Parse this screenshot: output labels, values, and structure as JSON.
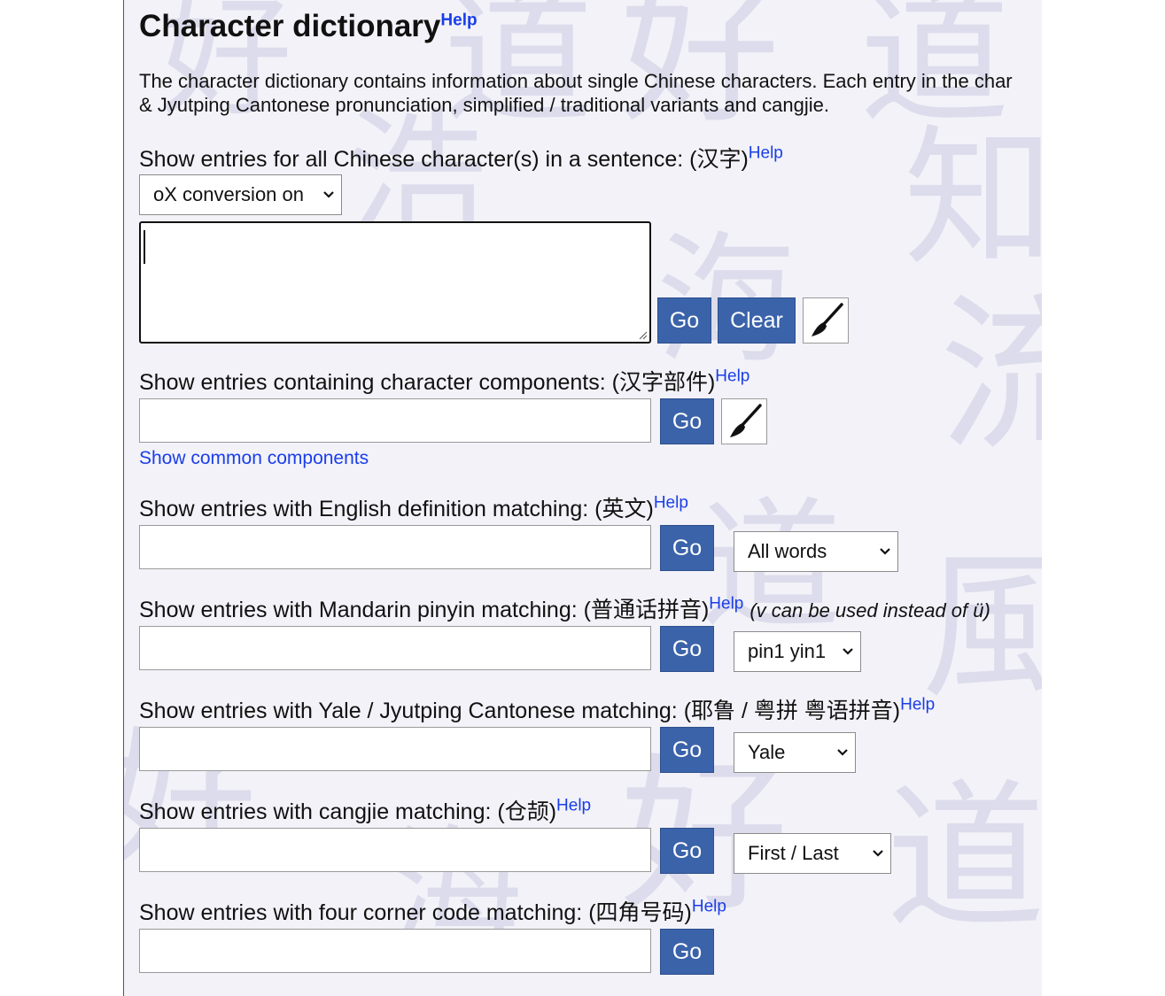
{
  "page": {
    "title": "Character dictionary",
    "help_label": "Help",
    "intro_line1": "The character dictionary contains information about single Chinese characters. Each entry in the char",
    "intro_line2": "& Jyutping Cantonese pronunciation, simplified / traditional variants and cangjie."
  },
  "sentence": {
    "label": "Show entries for all Chinese character(s) in a sentence: (汉字)",
    "help": "Help",
    "conversion_select": "oX conversion on",
    "textarea_value": "",
    "go": "Go",
    "clear": "Clear"
  },
  "components": {
    "label": "Show entries containing character components: (汉字部件)",
    "help": "Help",
    "input_value": "",
    "go": "Go",
    "link": "Show common components"
  },
  "english": {
    "label": "Show entries with English definition matching: (英文)",
    "help": "Help",
    "input_value": "",
    "go": "Go",
    "select": "All words"
  },
  "pinyin": {
    "label": "Show entries with Mandarin pinyin matching: (普通话拼音)",
    "help": "Help",
    "note": "(v can be used instead of ü)",
    "input_value": "",
    "go": "Go",
    "select": "pin1 yin1"
  },
  "cantonese": {
    "label": "Show entries with Yale / Jyutping Cantonese matching: (耶鲁 / 粤拼 粤语拼音)",
    "help": "Help",
    "input_value": "",
    "go": "Go",
    "select": "Yale"
  },
  "cangjie": {
    "label": "Show entries with cangjie matching: (仓颉)",
    "help": "Help",
    "input_value": "",
    "go": "Go",
    "select": "First / Last"
  },
  "fourcorner": {
    "label": "Show entries with four corner code matching: (四角号码)",
    "help": "Help",
    "input_value": "",
    "go": "Go"
  },
  "colors": {
    "button": "#3b63a9",
    "link": "#1a3ee8",
    "background": "#f2f2f8"
  },
  "icons": {
    "chevron": "chevron-down-icon",
    "brush": "brush-icon"
  }
}
